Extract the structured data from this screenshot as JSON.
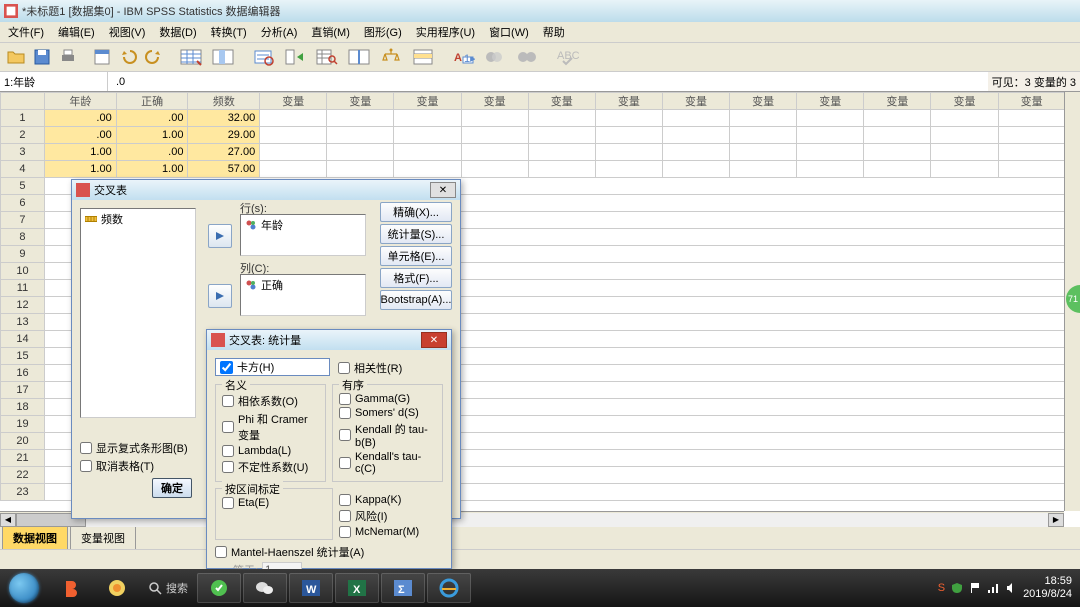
{
  "title": "*未标题1 [数据集0] - IBM SPSS Statistics 数据编辑器",
  "menu": [
    "文件(F)",
    "编辑(E)",
    "视图(V)",
    "数据(D)",
    "转换(T)",
    "分析(A)",
    "直销(M)",
    "图形(G)",
    "实用程序(U)",
    "窗口(W)",
    "帮助"
  ],
  "cell": {
    "addr": "1:年龄",
    "val": ".0",
    "visible": "可见：3 变量的 3"
  },
  "cols": [
    "年龄",
    "正确",
    "频数"
  ],
  "empty_col": "变量",
  "rows": [
    {
      "n": "1",
      "c": [
        ".00",
        ".00",
        "32.00"
      ]
    },
    {
      "n": "2",
      "c": [
        ".00",
        "1.00",
        "29.00"
      ]
    },
    {
      "n": "3",
      "c": [
        "1.00",
        ".00",
        "27.00"
      ]
    },
    {
      "n": "4",
      "c": [
        "1.00",
        "1.00",
        "57.00"
      ]
    }
  ],
  "tabs": {
    "data": "数据视图",
    "var": "变量视图"
  },
  "crosstab": {
    "title": "交叉表",
    "source_item": "频数",
    "rows_label": "行(s):",
    "rows_item": "年龄",
    "cols_label": "列(C):",
    "cols_item": "正确",
    "buttons": [
      "精确(X)...",
      "统计量(S)...",
      "单元格(E)...",
      "格式(F)...",
      "Bootstrap(A)..."
    ],
    "opt_cluster": "显示复式条形图(B)",
    "opt_suppress": "取消表格(T)",
    "ok": "确定"
  },
  "stats": {
    "title": "交叉表: 统计量",
    "chi": "卡方(H)",
    "corr": "相关性(R)",
    "nominal": {
      "legend": "名义",
      "items": [
        "相依系数(O)",
        "Phi 和 Cramer 变量",
        "Lambda(L)",
        "不定性系数(U)"
      ]
    },
    "ordinal": {
      "legend": "有序",
      "items": [
        "Gamma(G)",
        "Somers' d(S)",
        "Kendall 的 tau-b(B)",
        "Kendall's tau-c(C)"
      ]
    },
    "interval": {
      "legend": "按区间标定",
      "items": [
        "Eta(E)"
      ]
    },
    "other": [
      "Kappa(K)",
      "风险(I)",
      "McNemar(M)"
    ],
    "cmh": "Mantel-Haenszel 统计量(A)",
    "cmh_eq": "等于:",
    "cmh_val": "1"
  },
  "taskbar": {
    "search": "搜索",
    "time": "18:59",
    "date": "2019/8/24"
  },
  "bubble": "71"
}
